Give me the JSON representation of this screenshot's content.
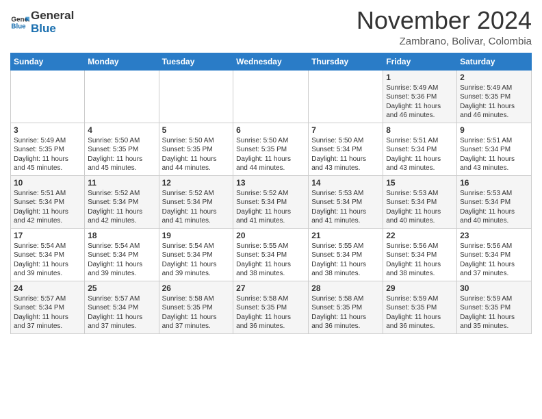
{
  "header": {
    "logo_line1": "General",
    "logo_line2": "Blue",
    "month": "November 2024",
    "location": "Zambrano, Bolivar, Colombia"
  },
  "weekdays": [
    "Sunday",
    "Monday",
    "Tuesday",
    "Wednesday",
    "Thursday",
    "Friday",
    "Saturday"
  ],
  "weeks": [
    [
      {
        "day": "",
        "info": ""
      },
      {
        "day": "",
        "info": ""
      },
      {
        "day": "",
        "info": ""
      },
      {
        "day": "",
        "info": ""
      },
      {
        "day": "",
        "info": ""
      },
      {
        "day": "1",
        "info": "Sunrise: 5:49 AM\nSunset: 5:36 PM\nDaylight: 11 hours\nand 46 minutes."
      },
      {
        "day": "2",
        "info": "Sunrise: 5:49 AM\nSunset: 5:35 PM\nDaylight: 11 hours\nand 46 minutes."
      }
    ],
    [
      {
        "day": "3",
        "info": "Sunrise: 5:49 AM\nSunset: 5:35 PM\nDaylight: 11 hours\nand 45 minutes."
      },
      {
        "day": "4",
        "info": "Sunrise: 5:50 AM\nSunset: 5:35 PM\nDaylight: 11 hours\nand 45 minutes."
      },
      {
        "day": "5",
        "info": "Sunrise: 5:50 AM\nSunset: 5:35 PM\nDaylight: 11 hours\nand 44 minutes."
      },
      {
        "day": "6",
        "info": "Sunrise: 5:50 AM\nSunset: 5:35 PM\nDaylight: 11 hours\nand 44 minutes."
      },
      {
        "day": "7",
        "info": "Sunrise: 5:50 AM\nSunset: 5:34 PM\nDaylight: 11 hours\nand 43 minutes."
      },
      {
        "day": "8",
        "info": "Sunrise: 5:51 AM\nSunset: 5:34 PM\nDaylight: 11 hours\nand 43 minutes."
      },
      {
        "day": "9",
        "info": "Sunrise: 5:51 AM\nSunset: 5:34 PM\nDaylight: 11 hours\nand 43 minutes."
      }
    ],
    [
      {
        "day": "10",
        "info": "Sunrise: 5:51 AM\nSunset: 5:34 PM\nDaylight: 11 hours\nand 42 minutes."
      },
      {
        "day": "11",
        "info": "Sunrise: 5:52 AM\nSunset: 5:34 PM\nDaylight: 11 hours\nand 42 minutes."
      },
      {
        "day": "12",
        "info": "Sunrise: 5:52 AM\nSunset: 5:34 PM\nDaylight: 11 hours\nand 41 minutes."
      },
      {
        "day": "13",
        "info": "Sunrise: 5:52 AM\nSunset: 5:34 PM\nDaylight: 11 hours\nand 41 minutes."
      },
      {
        "day": "14",
        "info": "Sunrise: 5:53 AM\nSunset: 5:34 PM\nDaylight: 11 hours\nand 41 minutes."
      },
      {
        "day": "15",
        "info": "Sunrise: 5:53 AM\nSunset: 5:34 PM\nDaylight: 11 hours\nand 40 minutes."
      },
      {
        "day": "16",
        "info": "Sunrise: 5:53 AM\nSunset: 5:34 PM\nDaylight: 11 hours\nand 40 minutes."
      }
    ],
    [
      {
        "day": "17",
        "info": "Sunrise: 5:54 AM\nSunset: 5:34 PM\nDaylight: 11 hours\nand 39 minutes."
      },
      {
        "day": "18",
        "info": "Sunrise: 5:54 AM\nSunset: 5:34 PM\nDaylight: 11 hours\nand 39 minutes."
      },
      {
        "day": "19",
        "info": "Sunrise: 5:54 AM\nSunset: 5:34 PM\nDaylight: 11 hours\nand 39 minutes."
      },
      {
        "day": "20",
        "info": "Sunrise: 5:55 AM\nSunset: 5:34 PM\nDaylight: 11 hours\nand 38 minutes."
      },
      {
        "day": "21",
        "info": "Sunrise: 5:55 AM\nSunset: 5:34 PM\nDaylight: 11 hours\nand 38 minutes."
      },
      {
        "day": "22",
        "info": "Sunrise: 5:56 AM\nSunset: 5:34 PM\nDaylight: 11 hours\nand 38 minutes."
      },
      {
        "day": "23",
        "info": "Sunrise: 5:56 AM\nSunset: 5:34 PM\nDaylight: 11 hours\nand 37 minutes."
      }
    ],
    [
      {
        "day": "24",
        "info": "Sunrise: 5:57 AM\nSunset: 5:34 PM\nDaylight: 11 hours\nand 37 minutes."
      },
      {
        "day": "25",
        "info": "Sunrise: 5:57 AM\nSunset: 5:34 PM\nDaylight: 11 hours\nand 37 minutes."
      },
      {
        "day": "26",
        "info": "Sunrise: 5:58 AM\nSunset: 5:35 PM\nDaylight: 11 hours\nand 37 minutes."
      },
      {
        "day": "27",
        "info": "Sunrise: 5:58 AM\nSunset: 5:35 PM\nDaylight: 11 hours\nand 36 minutes."
      },
      {
        "day": "28",
        "info": "Sunrise: 5:58 AM\nSunset: 5:35 PM\nDaylight: 11 hours\nand 36 minutes."
      },
      {
        "day": "29",
        "info": "Sunrise: 5:59 AM\nSunset: 5:35 PM\nDaylight: 11 hours\nand 36 minutes."
      },
      {
        "day": "30",
        "info": "Sunrise: 5:59 AM\nSunset: 5:35 PM\nDaylight: 11 hours\nand 35 minutes."
      }
    ]
  ]
}
